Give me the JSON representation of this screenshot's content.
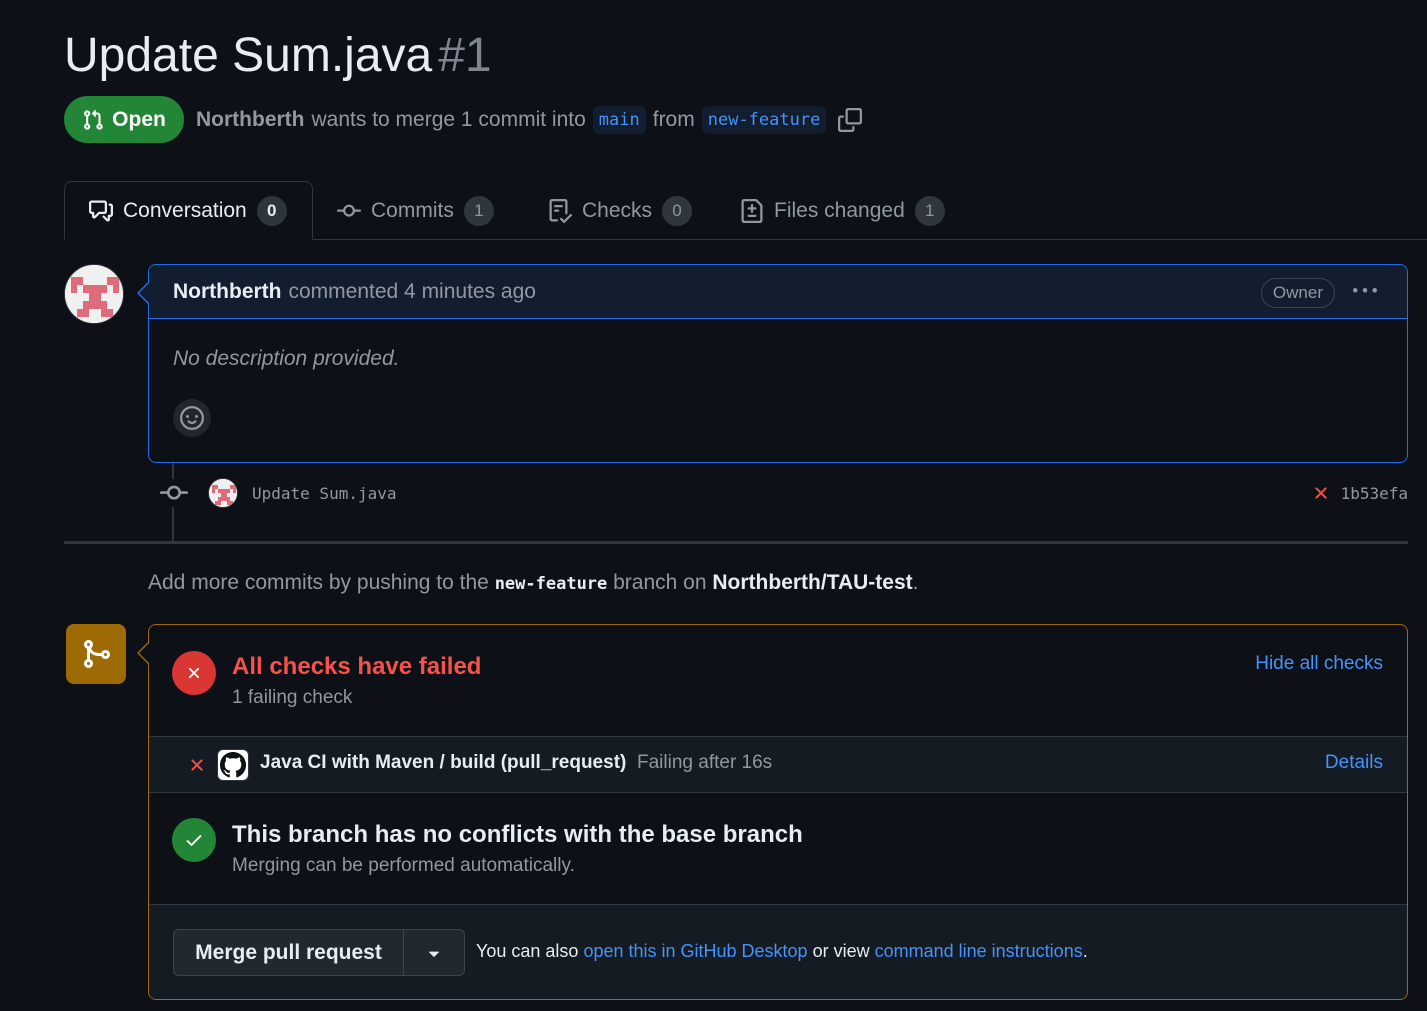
{
  "pr": {
    "title": "Update Sum.java",
    "number": "#1",
    "state": "Open",
    "author": "Northberth",
    "merge_text": "wants to merge 1 commit into",
    "base_branch": "main",
    "from_text": "from",
    "head_branch": "new-feature"
  },
  "tabs": [
    {
      "label": "Conversation",
      "count": "0",
      "icon": "comment-discussion-icon"
    },
    {
      "label": "Commits",
      "count": "1",
      "icon": "git-commit-icon"
    },
    {
      "label": "Checks",
      "count": "0",
      "icon": "checklist-icon"
    },
    {
      "label": "Files changed",
      "count": "1",
      "icon": "file-diff-icon"
    }
  ],
  "comment": {
    "author": "Northberth",
    "meta": "commented 4 minutes ago",
    "role_badge": "Owner",
    "body": "No description provided."
  },
  "commit": {
    "message": "Update Sum.java",
    "sha": "1b53efa",
    "status": "failed"
  },
  "hint": {
    "prefix": "Add more commits by pushing to the",
    "branch": "new-feature",
    "middle": "branch on",
    "repo": "Northberth/TAU-test",
    "suffix": "."
  },
  "checks": {
    "title": "All checks have failed",
    "subtitle": "1 failing check",
    "toggle_label": "Hide all checks",
    "items": [
      {
        "name": "Java CI with Maven / build (pull_request)",
        "status": "Failing after 16s",
        "link": "Details"
      }
    ]
  },
  "conflicts": {
    "title": "This branch has no conflicts with the base branch",
    "subtitle": "Merging can be performed automatically."
  },
  "merge": {
    "button_label": "Merge pull request",
    "text_prefix": "You can also",
    "desktop_link": "open this in GitHub Desktop",
    "text_middle": "or view",
    "cli_link": "command line instructions",
    "text_suffix": "."
  },
  "colors": {
    "background": "#0d1117",
    "open_green": "#238636",
    "fail_red": "#da3633",
    "link_blue": "#4493f8",
    "warning_border": "#9e6a03"
  }
}
